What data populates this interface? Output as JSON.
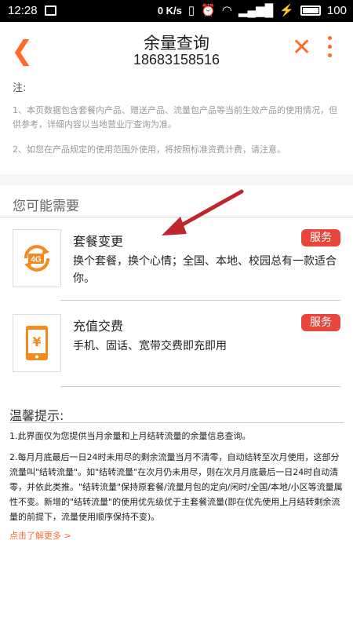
{
  "status": {
    "time": "12:28",
    "speed": "0 K/s",
    "battery": "100"
  },
  "header": {
    "title": "余量查询",
    "phone": "18683158516"
  },
  "notes": {
    "label": "注:",
    "items": [
      "1、本页数据包含套餐内产品、赠送产品、流量包产品等当前生效产品的使用情况，但供参考，详细内容以当地营业厅查询为准。",
      "2、如您在产品规定的使用范围外使用，将按照标准资费计费，请注意。"
    ]
  },
  "section_title": "您可能需要",
  "cards": [
    {
      "name": "套餐变更",
      "badge": "服务",
      "desc": "换个套餐，换个心情；全国、本地、校园总有一款适合你。",
      "icon": "4g-refresh-icon"
    },
    {
      "name": "充值交费",
      "badge": "服务",
      "desc": "手机、固话、宽带交费即充即用",
      "icon": "phone-yen-icon"
    }
  ],
  "tips": {
    "title": "温馨提示:",
    "items": [
      "1.此界面仅为您提供当月余量和上月结转流量的余量信息查询。",
      "2.每月月底最后一日24时未用尽的剩余流量当月不清零，自动结转至次月使用，这部分流量叫\"结转流量\"。如\"结转流量\"在次月仍未用尽，则在次月月底最后一日24时自动清零，并依此类推。\"结转流量\"保持原套餐/流量月包的定向/闲时/全国/本地/小区等流量属性不变。新增的\"结转流量\"的使用优先级优于主套餐流量(即在优先使用上月结转剩余流量的前提下，流量使用顺序保持不变)。"
    ],
    "more_link": "点击了解更多 >"
  },
  "colors": {
    "accent": "#ff6a2b",
    "badge": "#e8453c",
    "annotation_arrow": "#c0262d"
  }
}
